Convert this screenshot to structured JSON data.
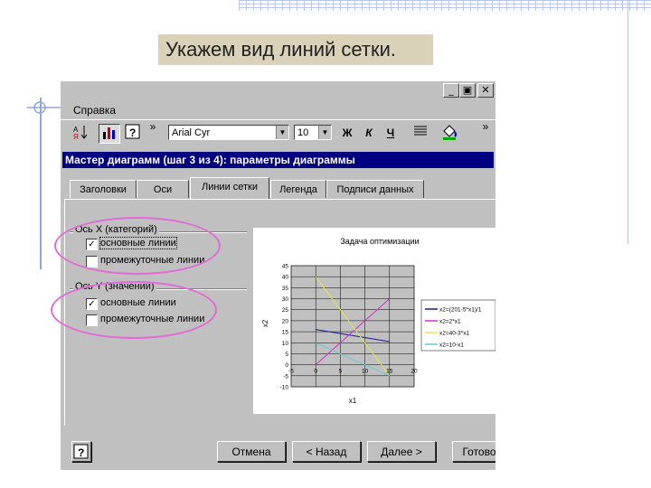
{
  "slide": {
    "title": "Укажем вид линий сетки."
  },
  "window": {
    "menu": {
      "help_label": "Справка"
    },
    "controls": {
      "minimize": "_",
      "restore": "▣",
      "close": "✕"
    },
    "toolbar": {
      "font_name": "Arial Cyr",
      "font_size": "10",
      "bold_label": "Ж",
      "italic_label": "К",
      "underline_label": "Ч",
      "more_label": "»"
    }
  },
  "dialog": {
    "title": "Мастер диаграмм (шаг 3 из 4): параметры диаграммы",
    "tabs": [
      {
        "label": "Заголовки"
      },
      {
        "label": "Оси"
      },
      {
        "label": "Линии сетки"
      },
      {
        "label": "Легенда"
      },
      {
        "label": "Подписи данных"
      }
    ],
    "active_tab": "Линии сетки",
    "x_axis_group": {
      "label": "Ось X (категорий)",
      "major": {
        "label": "основные линии",
        "checked": true
      },
      "minor": {
        "label": "промежуточные линии",
        "checked": false
      }
    },
    "y_axis_group": {
      "label": "Ось Y (значений)",
      "major": {
        "label": "основные линии",
        "checked": true
      },
      "minor": {
        "label": "промежуточные линии",
        "checked": false
      }
    },
    "buttons": {
      "help": "?",
      "cancel": "Отмена",
      "back": "< Назад",
      "next": "Далее >",
      "finish": "Готово"
    }
  },
  "chart_data": {
    "type": "line",
    "title": "Задача оптимизации",
    "xlabel": "x1",
    "ylabel": "x2",
    "xlim": [
      -5,
      20
    ],
    "ylim": [
      -10,
      45
    ],
    "x_ticks": [
      "-5",
      "0",
      "5",
      "10",
      "15",
      "20"
    ],
    "y_ticks": [
      "45",
      "40",
      "35",
      "30",
      "25",
      "20",
      "15",
      "10",
      "5",
      "0",
      "-5",
      "-10"
    ],
    "grid": true,
    "legend_position": "right",
    "series": [
      {
        "name": "x2=(201-5*x1)/1",
        "color": "#1a1a8c",
        "x": [
          0,
          15
        ],
        "y": [
          16,
          10.5
        ]
      },
      {
        "name": "x2=2*x1",
        "color": "#cc33cc",
        "x": [
          0,
          15
        ],
        "y": [
          0,
          30
        ]
      },
      {
        "name": "x2=40-3*x1",
        "color": "#e6e64d",
        "x": [
          0,
          15
        ],
        "y": [
          40,
          -5
        ]
      },
      {
        "name": "x2=10-x1",
        "color": "#66cccc",
        "x": [
          0,
          15
        ],
        "y": [
          10,
          -5
        ]
      }
    ]
  }
}
